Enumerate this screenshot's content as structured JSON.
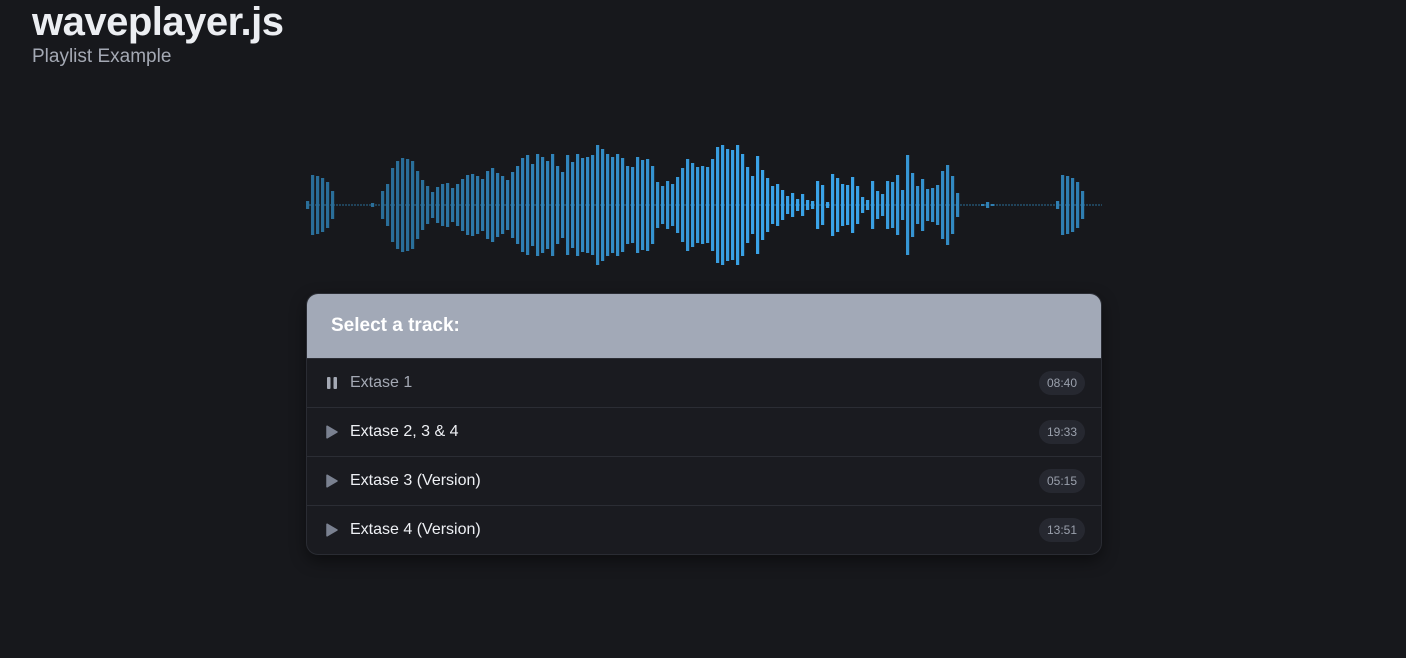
{
  "header": {
    "title": "waveplayer.js",
    "subtitle": "Playlist Example"
  },
  "waveform": {
    "color_base": "#2a6e99",
    "color_accent": "#3aa3e8",
    "baseline_color": "#2a6e99"
  },
  "playlist": {
    "heading": "Select a track:",
    "tracks": [
      {
        "title": "Extase 1",
        "duration": "08:40",
        "state": "playing",
        "icon": "pause-icon"
      },
      {
        "title": "Extase 2, 3 & 4",
        "duration": "19:33",
        "state": "idle",
        "icon": "play-icon"
      },
      {
        "title": "Extase 3 (Version)",
        "duration": "05:15",
        "state": "idle",
        "icon": "play-icon"
      },
      {
        "title": "Extase 4 (Version)",
        "duration": "13:51",
        "state": "idle",
        "icon": "play-icon"
      }
    ]
  },
  "colors": {
    "background": "#17181c",
    "header_bar": "#a2a9b7",
    "icon_gray": "#7a8190"
  }
}
